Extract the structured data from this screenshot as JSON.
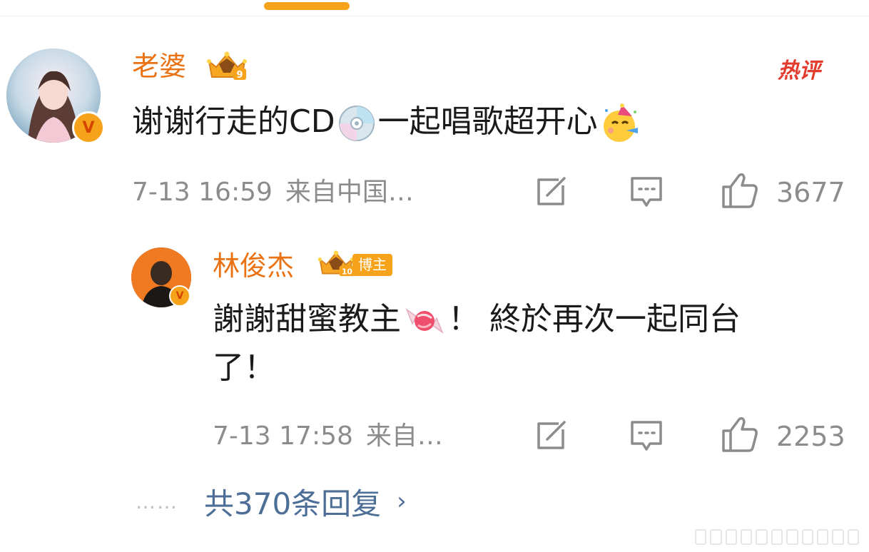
{
  "accent_colors": {
    "username": "#eb7213",
    "link": "#4d6e96",
    "tab_indicator": "#f7a21b",
    "hot_tag": "#e33b2c"
  },
  "comment": {
    "username": "老婆",
    "badge_icon": "crown-level-9-icon",
    "hot_tag": "热评",
    "text_before_cd": "谢谢行走的CD",
    "text_after_cd": "一起唱歌超开心",
    "emojis": [
      "cd-disc-emoji",
      "party-face-emoji"
    ],
    "timestamp": "7-13 16:59",
    "source": "来自中国…",
    "like_count": "3677"
  },
  "reply": {
    "username": "林俊杰",
    "badge_icon": "crown-level-10-icon",
    "role_tag": "博主",
    "text_line1_before": "謝謝甜蜜教主",
    "text_line1_after": "！ 終於再次一起同台",
    "text_line2": "了！",
    "emojis": [
      "candy-emoji"
    ],
    "timestamp": "7-13 17:58",
    "source": "来自…",
    "like_count": "2253"
  },
  "more_replies": {
    "dots": "……",
    "label": "共370条回复",
    "chevron": "›"
  }
}
